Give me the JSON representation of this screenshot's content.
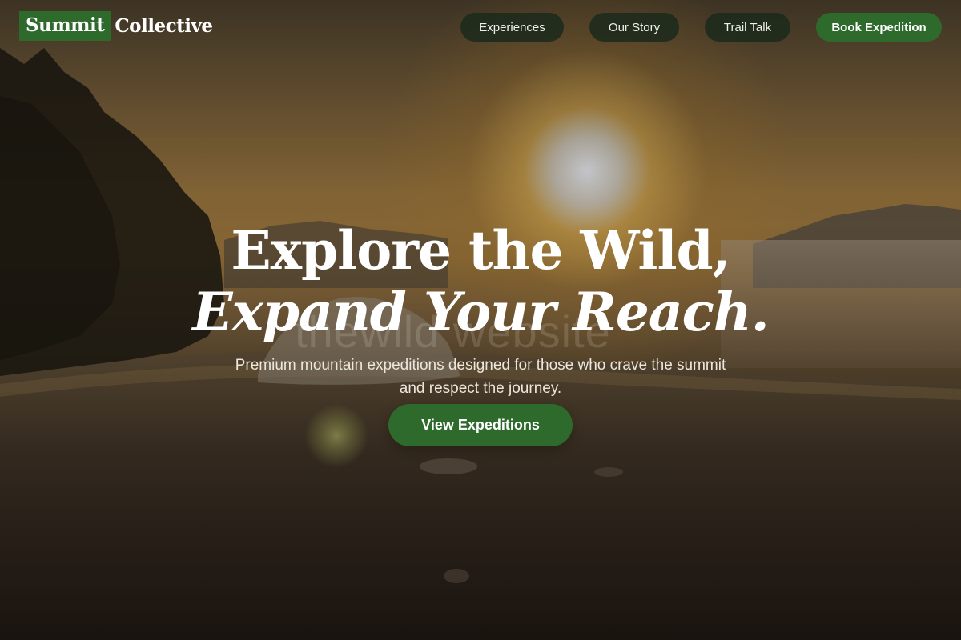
{
  "brand": {
    "name_highlight": "Summit",
    "name_rest": "Collective",
    "accent_color": "#2f6a2d"
  },
  "nav": {
    "items": [
      {
        "label": "Experiences"
      },
      {
        "label": "Our Story"
      },
      {
        "label": "Trail Talk"
      }
    ],
    "cta_label": "Book Expedition"
  },
  "hero": {
    "headline_line1": "Explore the Wild,",
    "headline_line2": "Expand Your Reach.",
    "subtitle": "Premium mountain expeditions designed for those who crave the summit and respect the journey.",
    "cta_label": "View Expeditions",
    "watermark": "thewild website",
    "background_image": "sunset-mountain-camp-photo"
  }
}
